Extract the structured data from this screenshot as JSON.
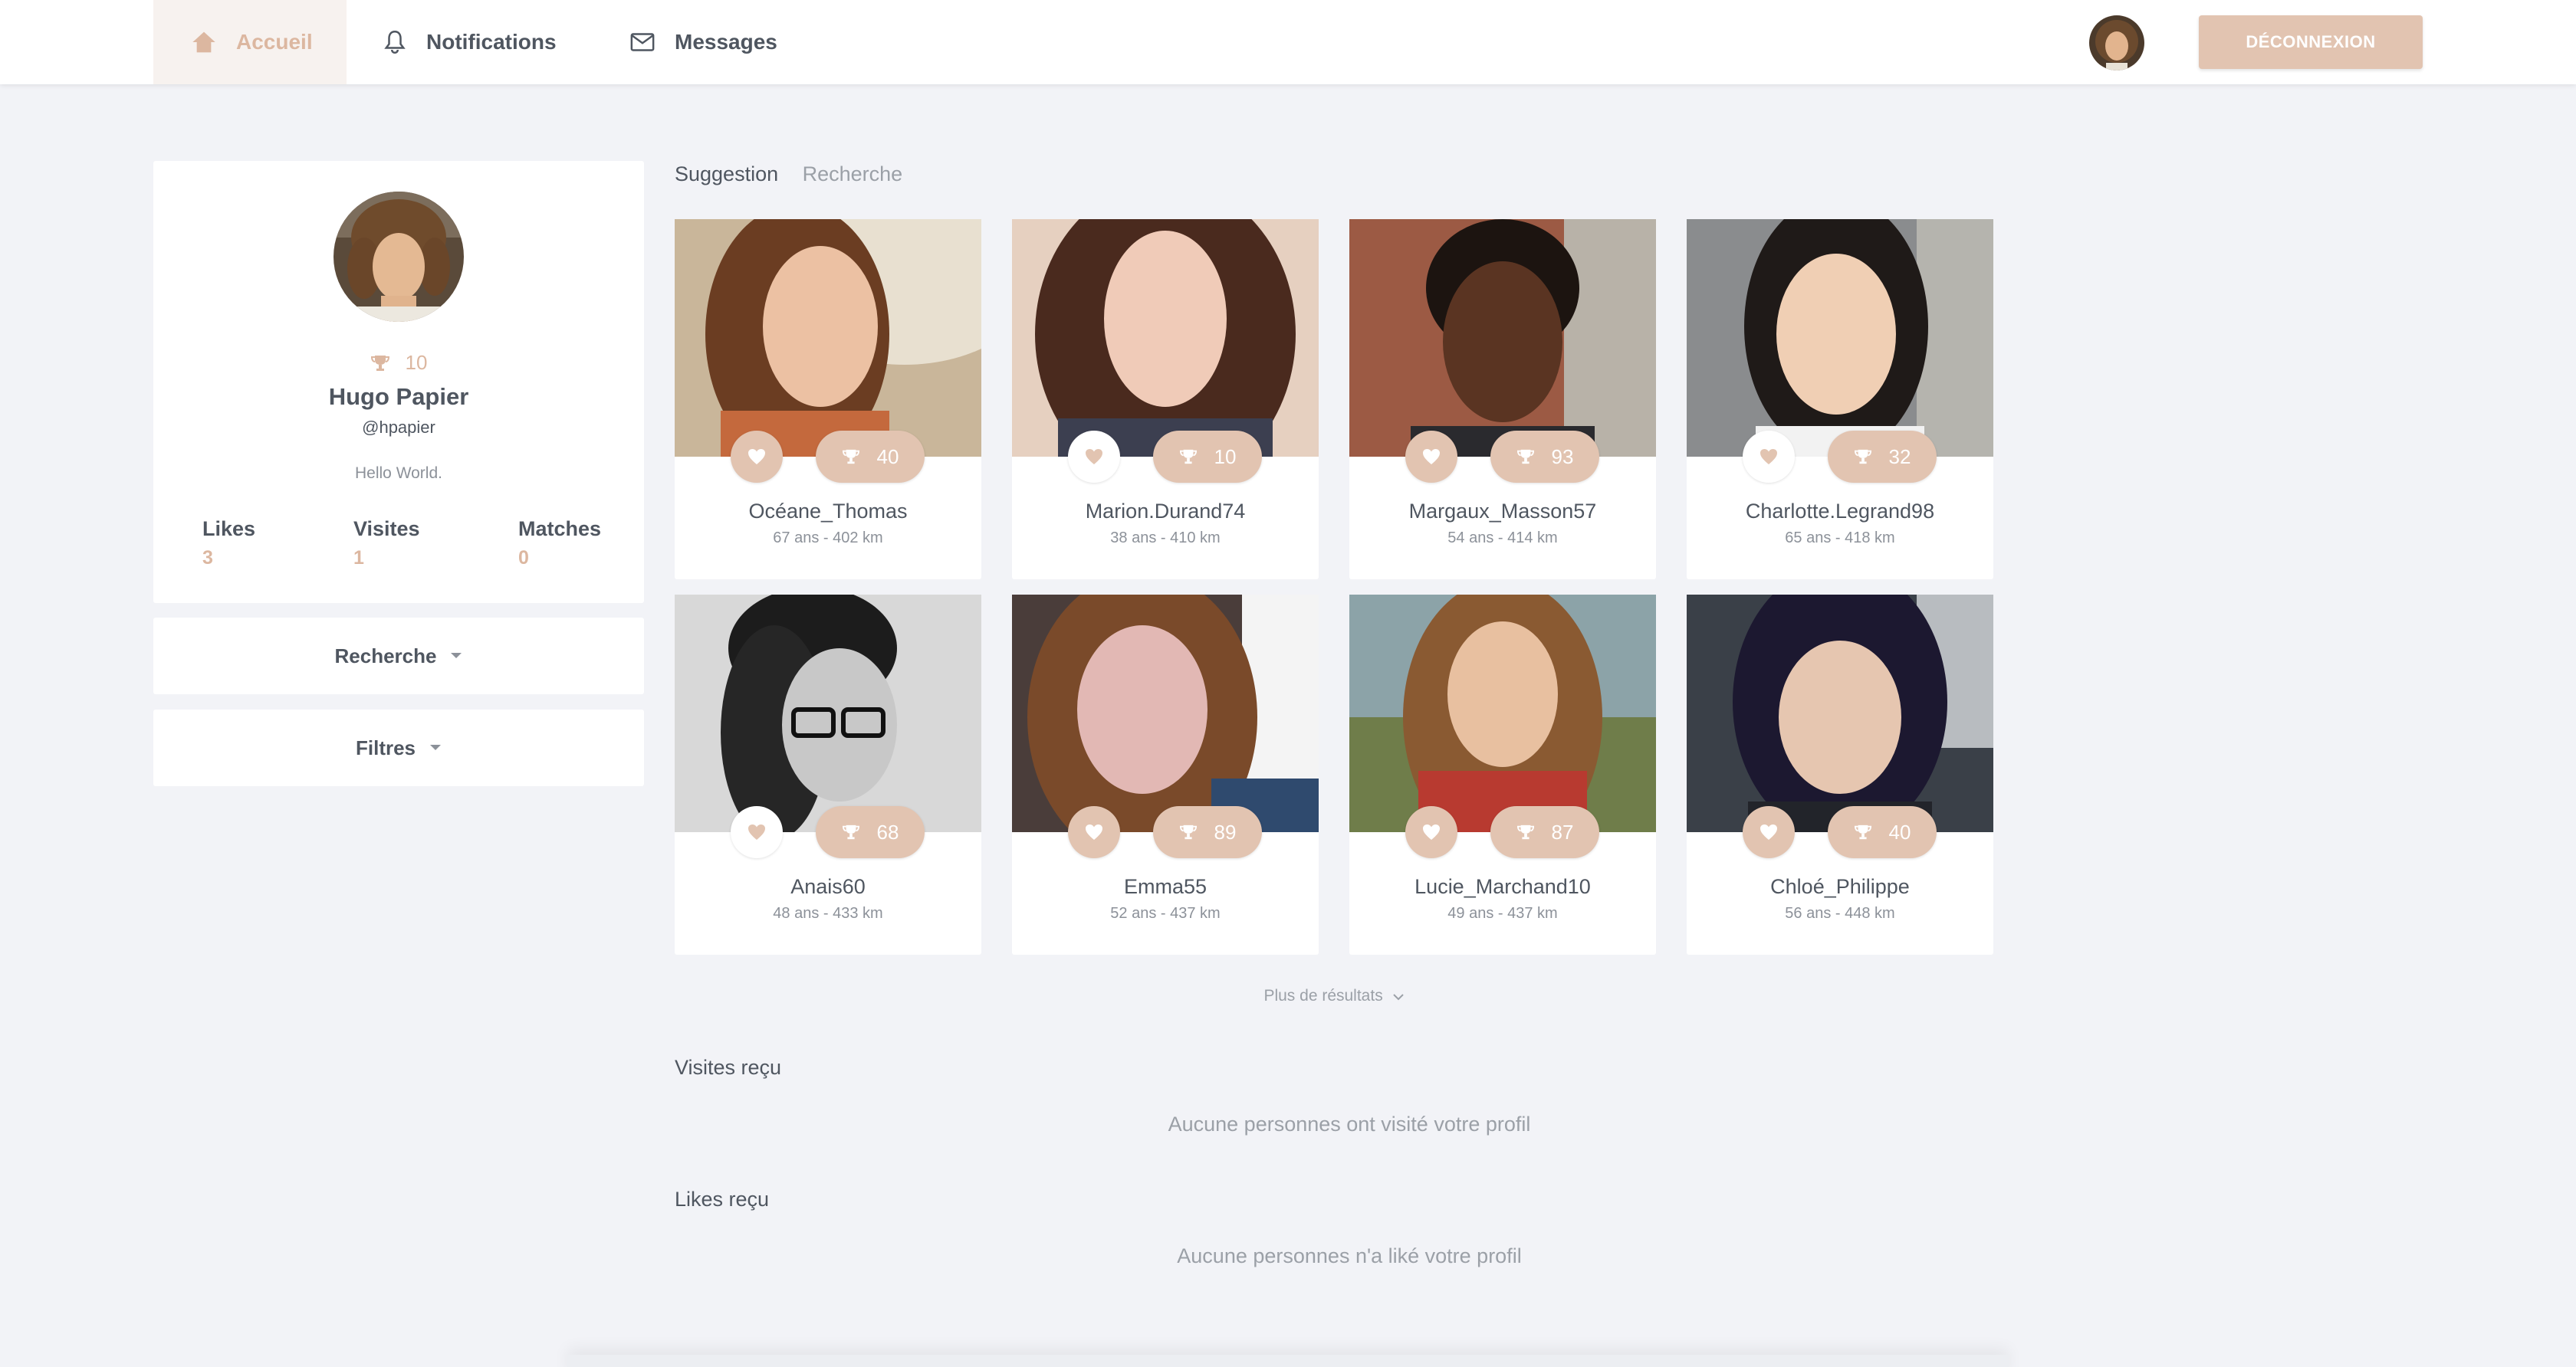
{
  "nav": {
    "items": [
      {
        "label": "Accueil",
        "icon": "home-icon",
        "active": true
      },
      {
        "label": "Notifications",
        "icon": "bell-icon",
        "active": false
      },
      {
        "label": "Messages",
        "icon": "envelope-icon",
        "active": false
      }
    ],
    "logout_label": "DÉCONNEXION"
  },
  "colors": {
    "accent": "#dcb7a0",
    "accent_button": "#e2c4b1",
    "background": "#f2f3f7",
    "text": "#4f5660",
    "muted": "#9ba0a7"
  },
  "profile": {
    "score": "10",
    "name": "Hugo Papier",
    "handle": "@hpapier",
    "bio": "Hello World.",
    "stats": [
      {
        "label": "Likes",
        "value": "3"
      },
      {
        "label": "Visites",
        "value": "1"
      },
      {
        "label": "Matches",
        "value": "0"
      }
    ]
  },
  "sidebar": {
    "search_label": "Recherche",
    "filters_label": "Filtres"
  },
  "tabs": {
    "suggestion": "Suggestion",
    "search": "Recherche"
  },
  "cards": [
    {
      "username": "Océane_Thomas",
      "meta": "67 ans - 402 km",
      "score": "40",
      "liked": true
    },
    {
      "username": "Marion.Durand74",
      "meta": "38 ans - 410 km",
      "score": "10",
      "liked": false
    },
    {
      "username": "Margaux_Masson57",
      "meta": "54 ans - 414 km",
      "score": "93",
      "liked": true
    },
    {
      "username": "Charlotte.Legrand98",
      "meta": "65 ans - 418 km",
      "score": "32",
      "liked": false
    },
    {
      "username": "Anais60",
      "meta": "48 ans - 433 km",
      "score": "68",
      "liked": false
    },
    {
      "username": "Emma55",
      "meta": "52 ans - 437 km",
      "score": "89",
      "liked": true
    },
    {
      "username": "Lucie_Marchand10",
      "meta": "49 ans - 437 km",
      "score": "87",
      "liked": true
    },
    {
      "username": "Chloé_Philippe",
      "meta": "56 ans - 448 km",
      "score": "40",
      "liked": true
    }
  ],
  "more_results": "Plus de résultats",
  "visits": {
    "title": "Visites reçu",
    "empty": "Aucune personnes ont visité votre profil"
  },
  "likes": {
    "title": "Likes reçu",
    "empty": "Aucune personnes n'a liké votre profil"
  }
}
